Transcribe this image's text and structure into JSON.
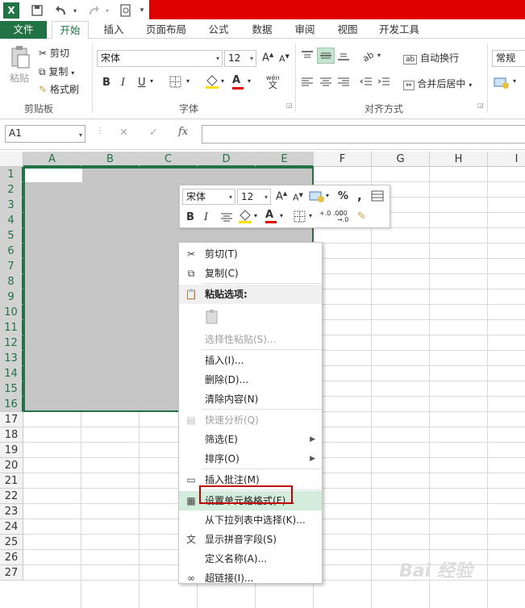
{
  "qat": {
    "icons": [
      "excel-logo-icon",
      "save-icon",
      "undo-icon",
      "redo-icon",
      "print-preview-icon",
      "customize-icon"
    ],
    "excel_letter": "X"
  },
  "tabs": [
    "文件",
    "开始",
    "插入",
    "页面布局",
    "公式",
    "数据",
    "审阅",
    "视图",
    "开发工具"
  ],
  "clipboard": {
    "paste": "粘贴",
    "cut": "剪切",
    "copy": "复制",
    "format_painter": "格式刷",
    "group": "剪贴板"
  },
  "font": {
    "name": "宋体",
    "size": "12",
    "group": "字体",
    "bold": "B",
    "italic": "I",
    "underline": "U",
    "grow": "A",
    "shrink": "A",
    "phonetic": "wén",
    "phonetic_char": "文",
    "font_color_letter": "A"
  },
  "align": {
    "wrap": "自动换行",
    "merge": "合并后居中",
    "group": "对齐方式"
  },
  "number": {
    "format": "常规"
  },
  "formula_bar": {
    "name_box": "A1",
    "fx": "fx",
    "cancel": "✕",
    "enter": "✓",
    "value": ""
  },
  "columns": [
    "A",
    "B",
    "C",
    "D",
    "E",
    "F",
    "G",
    "H",
    "I"
  ],
  "rows": [
    "1",
    "2",
    "3",
    "4",
    "5",
    "6",
    "7",
    "8",
    "9",
    "10",
    "11",
    "12",
    "13",
    "14",
    "15",
    "16",
    "17",
    "18",
    "19",
    "20",
    "21",
    "22",
    "23",
    "24",
    "25",
    "26",
    "27"
  ],
  "mini_toolbar": {
    "font": "宋体",
    "size": "12",
    "bold": "B",
    "italic": "I",
    "percent": "%",
    "comma": ",",
    "font_color_letter": "A",
    "inc_decimal": "+.0 .00",
    "dec_decimal": ".00 →.0"
  },
  "context_menu": [
    {
      "label": "剪切(T)",
      "icon": "cut-icon",
      "state": "normal"
    },
    {
      "label": "复制(C)",
      "icon": "copy-icon",
      "state": "normal"
    },
    {
      "label": "粘贴选项:",
      "icon": "paste-icon",
      "state": "header"
    },
    {
      "label": "",
      "icon": "paste-option-icon",
      "state": "blank"
    },
    {
      "label": "选择性粘贴(S)...",
      "icon": "",
      "state": "disabled"
    },
    {
      "label": "插入(I)...",
      "icon": "",
      "state": "normal"
    },
    {
      "label": "删除(D)...",
      "icon": "",
      "state": "normal"
    },
    {
      "label": "清除内容(N)",
      "icon": "",
      "state": "normal"
    },
    {
      "label": "快速分析(Q)",
      "icon": "quick-analysis-icon",
      "state": "disabled"
    },
    {
      "label": "筛选(E)",
      "icon": "",
      "state": "normal",
      "submenu": true
    },
    {
      "label": "排序(O)",
      "icon": "",
      "state": "normal",
      "submenu": true
    },
    {
      "label": "插入批注(M)",
      "icon": "insert-comment-icon",
      "state": "normal"
    },
    {
      "label": "设置单元格格式(F)...",
      "icon": "format-cells-icon",
      "state": "highlighted"
    },
    {
      "label": "从下拉列表中选择(K)...",
      "icon": "",
      "state": "normal"
    },
    {
      "label": "显示拼音字段(S)",
      "icon": "phonetic-icon",
      "state": "normal"
    },
    {
      "label": "定义名称(A)...",
      "icon": "",
      "state": "normal"
    },
    {
      "label": "超链接(I)...",
      "icon": "hyperlink-icon",
      "state": "normal"
    }
  ],
  "submenu_arrow": "▶",
  "watermark": "Bai 经验",
  "colors": {
    "excel_green": "#217346",
    "red": "#e00000",
    "selection": "#c6c6c6",
    "highlight": "#d4ecdc"
  }
}
